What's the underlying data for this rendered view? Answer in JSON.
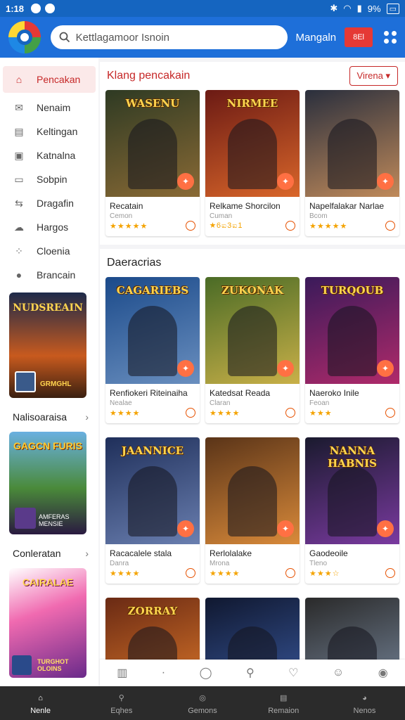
{
  "status": {
    "time": "1:18",
    "battery": "9%"
  },
  "appbar": {
    "search_placeholder": "Kettlagamoor Isnoin",
    "title": "Mangaln",
    "button": "8El"
  },
  "sidebar": {
    "items": [
      {
        "label": "Pencakan",
        "icon": "store-icon"
      },
      {
        "label": "Nenaim",
        "icon": "mail-icon"
      },
      {
        "label": "Keltingan",
        "icon": "document-icon"
      },
      {
        "label": "Katnalna",
        "icon": "briefcase-icon"
      },
      {
        "label": "Sobpin",
        "icon": "wallet-icon"
      },
      {
        "label": "Dragafin",
        "icon": "share-icon"
      },
      {
        "label": "Hargos",
        "icon": "cloud-icon"
      },
      {
        "label": "Cloenia",
        "icon": "dots-grid-icon"
      },
      {
        "label": "Brancain",
        "icon": "avatar-icon"
      }
    ],
    "promo1_title": "NUDSREAIN",
    "promo1_footer": "GRMGHL",
    "heading1": "Nalisoaraisa",
    "promo2_title": "GAGCN FURIS",
    "promo2_footer": "AMFERAS MENSIE",
    "heading2": "Conleratan",
    "promo3_title": "CAIRALAE",
    "promo3_footer": "TURGHOT OLOINS"
  },
  "featured": {
    "title": "Klang pencakain",
    "dropdown": "Virena",
    "cards": [
      {
        "logo": "WASENU",
        "name": "Recatain",
        "sub": "Cemon",
        "stars": "★★★★★",
        "colors": [
          "#2e3a23",
          "#8a6a35"
        ]
      },
      {
        "logo": "NIRMEE",
        "name": "Relkame Shorcilon",
        "sub": "Cuman",
        "stars": "★6ಐ3ಐ1",
        "colors": [
          "#6b1a14",
          "#d9662a"
        ]
      },
      {
        "logo": "",
        "name": "Napelfalakar Narlae",
        "sub": "Bcom",
        "stars": "★★★★★",
        "colors": [
          "#2a2f3d",
          "#c08a5a"
        ]
      }
    ]
  },
  "section2": {
    "title": "Daeracrias",
    "row1": [
      {
        "logo": "CAGARIEBS",
        "name": "Renfiokeri Riteinaiha",
        "sub": "Nealae",
        "stars": "★★★★",
        "colors": [
          "#1b4a8a",
          "#6a8fbf"
        ]
      },
      {
        "logo": "ZUKONAK",
        "name": "Katedsat Reada",
        "sub": "Claran",
        "stars": "★★★★",
        "colors": [
          "#4a6b26",
          "#c9b048"
        ]
      },
      {
        "logo": "TURQOUB",
        "name": "Naeroko Inile",
        "sub": "Feoan",
        "stars": "★★★",
        "colors": [
          "#3a1a5a",
          "#b02a6a"
        ]
      }
    ],
    "row2": [
      {
        "logo": "JAANNICE",
        "name": "Racacalele stala",
        "sub": "Danra",
        "stars": "★★★★",
        "colors": [
          "#1f2f5a",
          "#6a7fb0"
        ]
      },
      {
        "logo": "",
        "name": "Rerlolalake",
        "sub": "Mrona",
        "stars": "★★★★",
        "colors": [
          "#5a3418",
          "#d98a3a"
        ]
      },
      {
        "logo": "NANNA HABNIS",
        "name": "Gaodeoile",
        "sub": "Tleno",
        "stars": "★★★☆",
        "colors": [
          "#1a1a2e",
          "#7a3aa0"
        ]
      }
    ],
    "row3": [
      {
        "logo": "ZORRAY",
        "colors": [
          "#6a2a14",
          "#e07a2a"
        ]
      },
      {
        "logo": "",
        "colors": [
          "#101830",
          "#3a5aa0"
        ]
      },
      {
        "logo": "",
        "colors": [
          "#2a2a2a",
          "#7a8aa0"
        ]
      }
    ]
  },
  "tabbar": [
    {
      "label": "Nenle",
      "icon": "home-icon"
    },
    {
      "label": "Eqhes",
      "icon": "search-icon"
    },
    {
      "label": "Gemons",
      "icon": "compass-icon"
    },
    {
      "label": "Remaion",
      "icon": "library-icon"
    },
    {
      "label": "Nenos",
      "icon": "profile-icon"
    }
  ]
}
